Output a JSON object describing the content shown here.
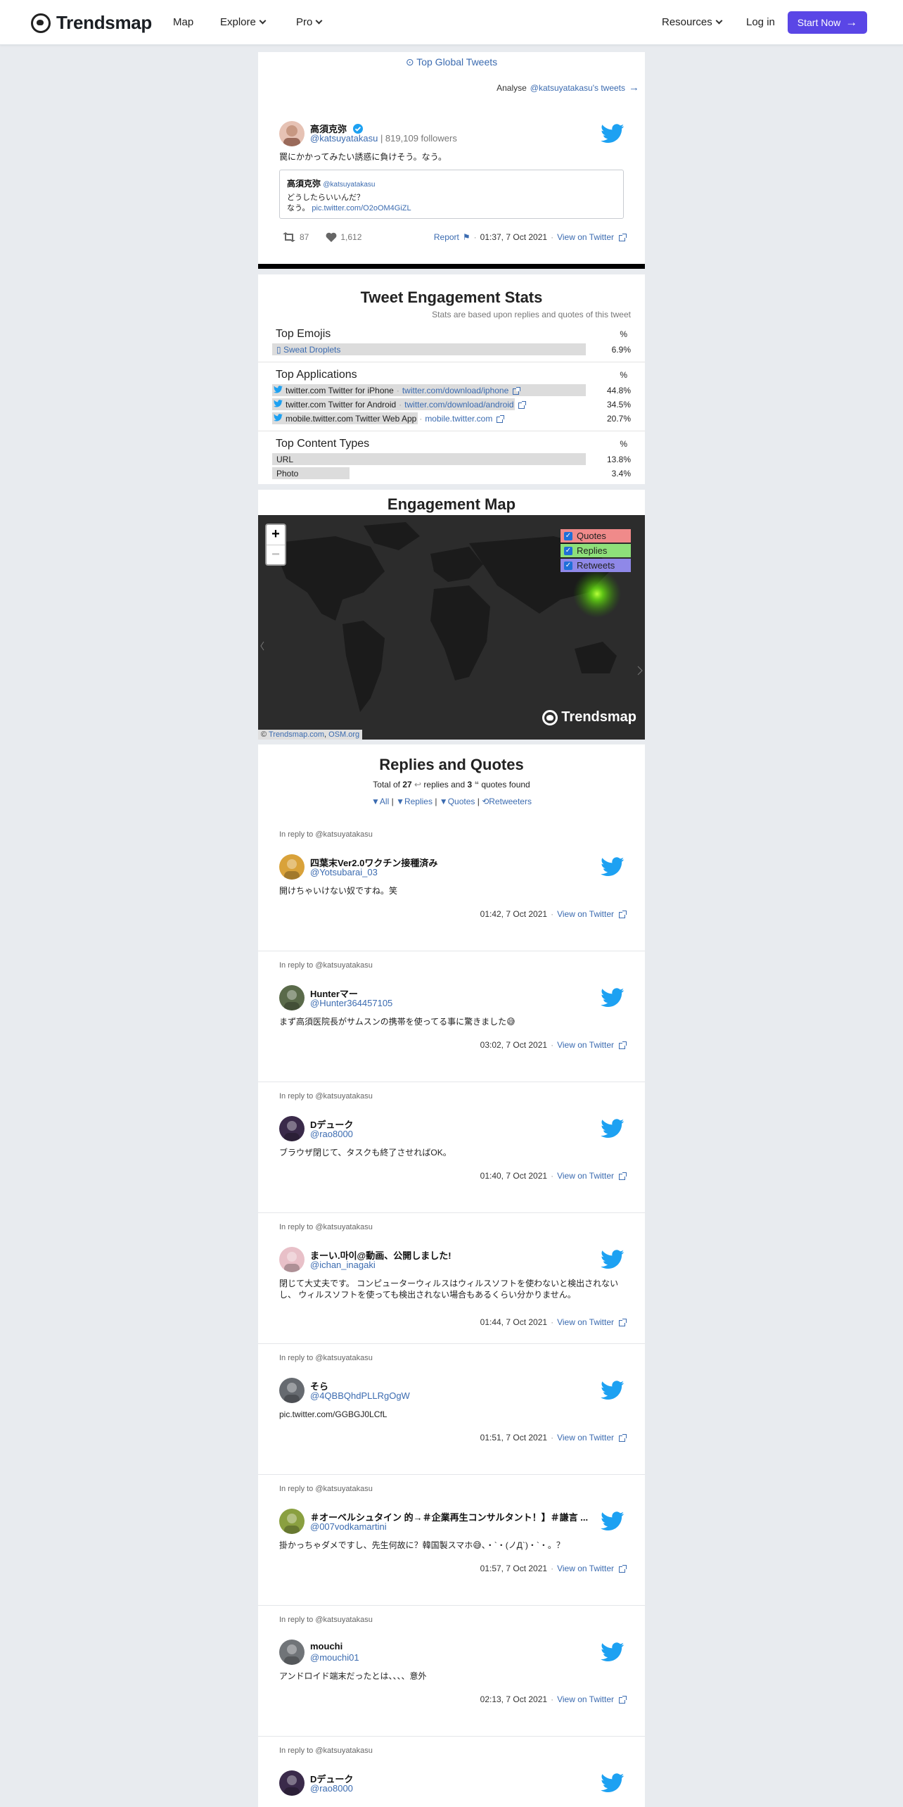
{
  "nav": {
    "brand": "Trendsmap",
    "items": [
      "Map",
      "Explore",
      "Pro"
    ],
    "right": [
      "Resources",
      "Log in"
    ],
    "start_label": "Start Now"
  },
  "main_tweet": {
    "top_global": "Top Global Tweets",
    "analyse_prefix": "Analyse",
    "analyse_link": "@katsuyatakasu's tweets",
    "name": "高須克弥",
    "handle": "@katsuyatakasu",
    "followers": "| 819,109 followers",
    "text": "罠にかかってみたい誘惑に負けそう。なう。",
    "quote": {
      "name": "高須克弥",
      "handle": "@katsuyatakasu",
      "line1": "どうしたらいいんだ？",
      "line2_prefix": "なう。",
      "link": "pic.twitter.com/O2oOM4GiZL"
    },
    "retweets": "87",
    "likes": "1,612",
    "report": "Report",
    "time": "01:37, 7 Oct 2021",
    "view": "View on Twitter"
  },
  "stats": {
    "title": "Tweet Engagement Stats",
    "subtitle": "Stats are based upon replies and quotes of this tweet",
    "pct_header": "%",
    "emojis": {
      "title": "Top Emojis",
      "rows": [
        {
          "label": "Sweat Droplets",
          "value": "6.9%",
          "fraction": 0.97
        }
      ]
    },
    "apps": {
      "title": "Top Applications",
      "rows": [
        {
          "label": "twitter.com Twitter for iPhone",
          "link": "twitter.com/download/iphone",
          "value": "44.8%",
          "fraction": 0.97
        },
        {
          "label": "twitter.com Twitter for Android",
          "link": "twitter.com/download/android",
          "value": "34.5%",
          "fraction": 0.75
        },
        {
          "label": "mobile.twitter.com Twitter Web App",
          "link": "mobile.twitter.com",
          "value": "20.7%",
          "fraction": 0.45
        }
      ]
    },
    "content": {
      "title": "Top Content Types",
      "rows": [
        {
          "label": "URL",
          "value": "13.8%",
          "fraction": 0.97
        },
        {
          "label": "Photo",
          "value": "3.4%",
          "fraction": 0.24
        }
      ]
    }
  },
  "map": {
    "title": "Engagement Map",
    "zoom_in": "+",
    "zoom_out": "−",
    "legend": [
      {
        "label": "Quotes",
        "color": "#f08a8a"
      },
      {
        "label": "Replies",
        "color": "#8ee07a"
      },
      {
        "label": "Retweets",
        "color": "#8f88e8"
      }
    ],
    "attrib_prefix": "©",
    "attrib_links": [
      "Trendsmap.com",
      "OSM.org"
    ],
    "brand": "Trendsmap"
  },
  "replies": {
    "title": "Replies and Quotes",
    "total_prefix": "Total of",
    "total_count": "27",
    "total_mid": "replies and",
    "quote_count": "3",
    "total_suffix": "quotes found",
    "filters": [
      "All",
      "Replies",
      "Quotes",
      "Retweeters"
    ],
    "in_reply": "In reply to @katsuyatakasu",
    "view": "View on Twitter",
    "items": [
      {
        "name": "四葉末Ver2.0ワクチン接種済み",
        "handle": "@Yotsubarai_03",
        "text": "開けちゃいけない奴ですね。笑",
        "time": "01:42, 7 Oct 2021",
        "avatar": "#d9a23a"
      },
      {
        "name": "Hunterマー",
        "handle": "@Hunter364457105",
        "text": "まず高須医院長がサムスンの携帯を使ってる事に驚きました😅",
        "time": "03:02, 7 Oct 2021",
        "avatar": "#5a6a4a"
      },
      {
        "name": "Dデューク",
        "handle": "@rao8000",
        "text": "ブラウザ閉じて、タスクも終了させればOK。",
        "time": "01:40, 7 Oct 2021",
        "avatar": "#3a2a4a"
      },
      {
        "name": "まーい.마이@動画、公開しました!",
        "handle": "@ichan_inagaki",
        "text": "閉じて大丈夫です。 コンピューターウィルスはウィルスソフトを使わないと検出されないし、 ウィルスソフトを使っても検出されない場合もあるくらい分かりません。",
        "time": "01:44, 7 Oct 2021",
        "avatar": "#e8c0c8"
      },
      {
        "name": "そら",
        "handle": "@4QBBQhdPLLRgOgW",
        "text": "",
        "link": "pic.twitter.com/GGBGJ0LCfL",
        "time": "01:51, 7 Oct 2021",
        "avatar": "#666a70"
      },
      {
        "name": "＃オーベルシュタイン 的→＃企業再生コンサルタント！】＃謙言 ...",
        "handle": "@007vodkamartini",
        "text": "掛かっちゃダメですし、先生何故に？韓国製スマホ😅、・`・(ノД`)・`・。？",
        "time": "01:57, 7 Oct 2021",
        "avatar": "#8aa040"
      },
      {
        "name": "mouchi",
        "handle": "@mouchi01",
        "text": "アンドロイド端末だったとは、、、、意外",
        "time": "02:13, 7 Oct 2021",
        "avatar": "#707478"
      },
      {
        "name": "Dデューク",
        "handle": "@rao8000",
        "text": "",
        "time": "",
        "avatar": "#3a2a4a"
      }
    ]
  }
}
